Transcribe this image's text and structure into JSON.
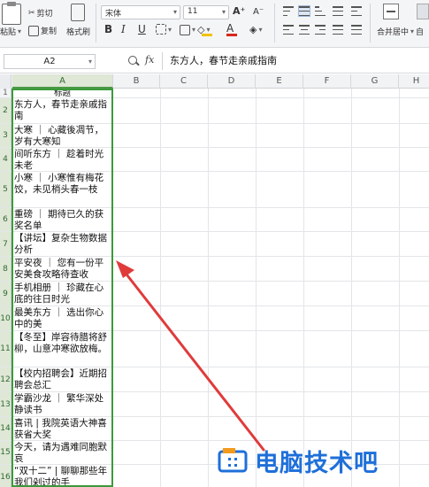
{
  "ribbon": {
    "paste_label": "粘贴",
    "cut_label": "剪切",
    "copy_label": "复制",
    "format_painter_label": "格式刷",
    "font_name": "宋体",
    "font_size": "11",
    "grow_label": "A⁺",
    "shrink_label": "A⁻",
    "bold_label": "B",
    "italic_label": "I",
    "underline_label": "U",
    "font_color_label": "A",
    "merge_label": "合并居中",
    "auto_label": "自",
    "fill_color": "#f2c200",
    "font_color": "#d9261c"
  },
  "formula_bar": {
    "name_box": "A2",
    "fx_label": "fx",
    "content": "东方人，春节走亲戚指南"
  },
  "columns": [
    "A",
    "B",
    "C",
    "D",
    "E",
    "F",
    "G",
    "H"
  ],
  "rows": [
    {
      "num": "1",
      "text": "标题"
    },
    {
      "num": "2",
      "text": "东方人，春节走亲戚指南"
    },
    {
      "num": "3",
      "text": "大寒 ｜ 心藏後凋节，岁有大寒知"
    },
    {
      "num": "4",
      "text": "间听东方 ｜ 趁着时光未老"
    },
    {
      "num": "5",
      "text": "小寒 ｜ 小寒惟有梅花饺，未见梢头春一枝"
    },
    {
      "num": "6",
      "text": "重磅 ｜ 期待已久的获奖名单"
    },
    {
      "num": "7",
      "text": "【讲坛】复杂生物数据分析"
    },
    {
      "num": "8",
      "text": "平安夜 ｜ 您有一份平安美食攻略待查收"
    },
    {
      "num": "9",
      "text": "手机相册 ｜ 珍藏在心底的往日时光"
    },
    {
      "num": "10",
      "text": "最美东方 ｜ 选出你心中的美"
    },
    {
      "num": "11",
      "text": "【冬至】岸容待腊将舒柳，山意冲寒欲放梅。"
    },
    {
      "num": "12",
      "text": "【校内招聘会】近期招聘会总汇"
    },
    {
      "num": "13",
      "text": "学霸沙龙 ｜ 繁华深处静读书"
    },
    {
      "num": "14",
      "text": "喜讯 | 我院英语大神喜获省大奖"
    },
    {
      "num": "15",
      "text": "今天，请为遇难同胞默哀"
    },
    {
      "num": "16",
      "text": "“双十二” | 聊聊那些年我们剁过的手"
    }
  ],
  "watermark": {
    "text": "电脑技术吧"
  }
}
